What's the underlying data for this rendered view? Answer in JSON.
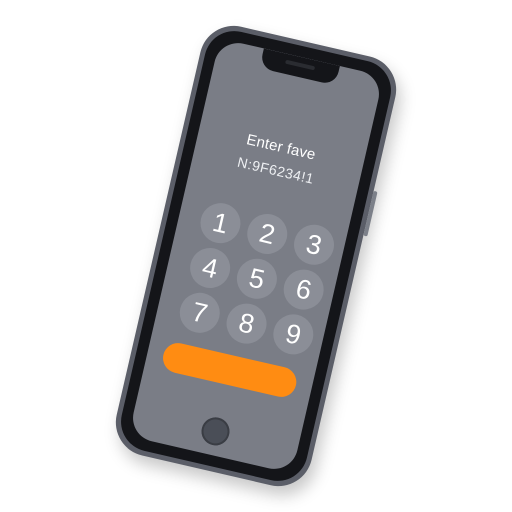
{
  "screen": {
    "title": "Enter fave",
    "code": "N:9F6234!1"
  },
  "keypad": {
    "keys": [
      "1",
      "2",
      "3",
      "4",
      "5",
      "6",
      "7",
      "8",
      "9"
    ]
  },
  "colors": {
    "accent": "#ff8c12",
    "screen": "#7a7d86",
    "key": "#8b8e97",
    "body": "#5b5e68"
  },
  "icons": {
    "home": "home-button-icon"
  }
}
